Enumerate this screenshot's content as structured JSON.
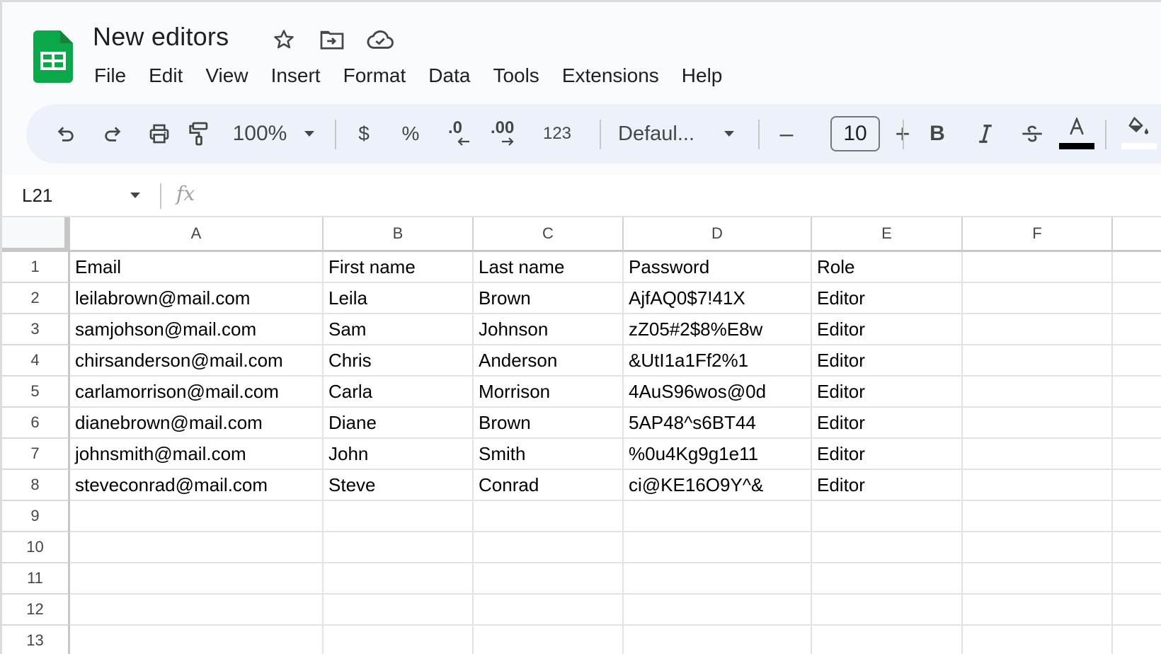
{
  "app": {
    "title": "New editors",
    "brand_color": "#0f9d58",
    "title_icons": [
      {
        "name": "star-icon"
      },
      {
        "name": "move-to-folder-icon"
      },
      {
        "name": "cloud-saved-icon"
      }
    ]
  },
  "menu": [
    "File",
    "Edit",
    "View",
    "Insert",
    "Format",
    "Data",
    "Tools",
    "Extensions",
    "Help"
  ],
  "toolbar": {
    "zoom": "100%",
    "currency": "$",
    "percent": "%",
    "decrease_decimal": ".0",
    "increase_decimal": ".00",
    "more_formats": "123",
    "font": "Defaul...",
    "font_size": "10",
    "minus": "–",
    "plus": "+",
    "bold": "B",
    "italic": "I",
    "text_color": "#000000",
    "fill_color": "#ffffff"
  },
  "formula_bar": {
    "name_box": "L21",
    "fx": "fx",
    "value": ""
  },
  "grid": {
    "columns": [
      "A",
      "B",
      "C",
      "D",
      "E",
      "F"
    ],
    "row_numbers": [
      "1",
      "2",
      "3",
      "4",
      "5",
      "6",
      "7",
      "8",
      "9",
      "10",
      "11",
      "12",
      "13"
    ],
    "rows": [
      [
        "Email",
        "First name",
        "Last name",
        "Password",
        "Role",
        ""
      ],
      [
        "leilabrown@mail.com",
        "Leila",
        "Brown",
        "AjfAQ0$7!41X",
        "Editor",
        ""
      ],
      [
        "samjohson@mail.com",
        "Sam",
        "Johnson",
        "zZ05#2$8%E8w",
        "Editor",
        ""
      ],
      [
        "chirsanderson@mail.com",
        "Chris",
        "Anderson",
        "&UtI1a1Ff2%1",
        "Editor",
        ""
      ],
      [
        "carlamorrison@mail.com",
        "Carla",
        "Morrison",
        "4AuS96wos@0d",
        "Editor",
        ""
      ],
      [
        "dianebrown@mail.com",
        "Diane",
        "Brown",
        "5AP48^s6BT44",
        "Editor",
        ""
      ],
      [
        "johnsmith@mail.com",
        "John",
        "Smith",
        "%0u4Kg9g1e11",
        "Editor",
        ""
      ],
      [
        "steveconrad@mail.com",
        "Steve",
        "Conrad",
        "ci@KE16O9Y^&",
        "Editor",
        ""
      ],
      [
        "",
        "",
        "",
        "",
        "",
        ""
      ],
      [
        "",
        "",
        "",
        "",
        "",
        ""
      ],
      [
        "",
        "",
        "",
        "",
        "",
        ""
      ],
      [
        "",
        "",
        "",
        "",
        "",
        ""
      ],
      [
        "",
        "",
        "",
        "",
        "",
        ""
      ]
    ]
  }
}
